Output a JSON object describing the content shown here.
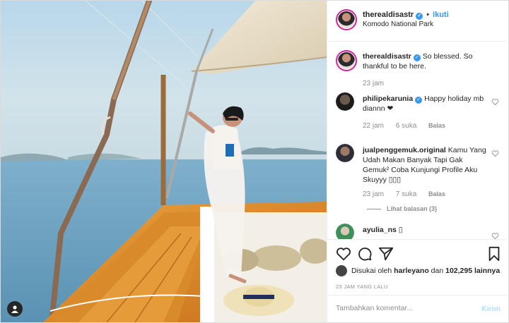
{
  "post": {
    "author": {
      "username": "therealdisastr",
      "verified": true,
      "follow_label": "Ikuti",
      "separator": "•",
      "location": "Komodo National Park"
    },
    "caption": {
      "username": "therealdisastr",
      "verified": true,
      "text": "So blessed. So thankful to be here.",
      "time": "23 jam"
    },
    "comments": [
      {
        "username": "philipekarunia",
        "verified": true,
        "text": "Happy holiday mb diannn ❤",
        "time": "22 jam",
        "likes": "6 suka",
        "reply_label": "Balas"
      },
      {
        "username": "jualpenggemuk.original",
        "verified": false,
        "text": "Kamu Yang Udah Makan Banyak Tapi Gak Gemuk² Coba Kunjungi Profile Aku Skuyyy ▯▯▯",
        "time": "23 jam",
        "likes": "7 suka",
        "reply_label": "Balas",
        "view_replies": "Lihat balasan (3)"
      },
      {
        "username": "ayulia_ns",
        "verified": false,
        "text": "▯",
        "time": "",
        "likes": "",
        "reply_label": ""
      }
    ],
    "liked_by": {
      "prefix": "Disukai oleh",
      "user": "harleyano",
      "connector": "dan",
      "others": "102,295 lainnya"
    },
    "time_ago": "23 JAM YANG LALU",
    "add_comment": {
      "placeholder": "Tambahkan komentar...",
      "send_label": "Kirim"
    }
  },
  "icons": {
    "like": "heart-icon",
    "comment": "comment-icon",
    "share": "paper-plane-icon",
    "save": "bookmark-icon",
    "tag": "user-tag-icon",
    "verified": "verified-badge-icon"
  },
  "colors": {
    "link_blue": "#3897f0",
    "muted": "#8e8e8e",
    "send_disabled": "#b2dffc",
    "story_ring": "#d6249f"
  }
}
